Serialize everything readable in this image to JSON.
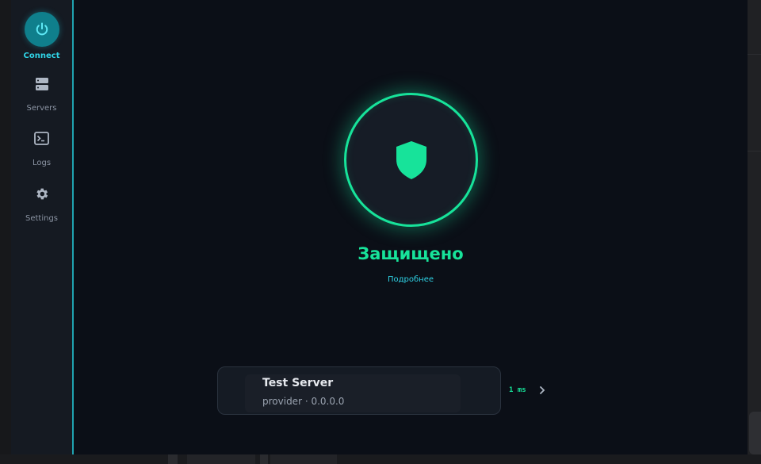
{
  "sidebar": {
    "items": [
      {
        "label": "Connect",
        "icon": "power-icon",
        "active": true
      },
      {
        "label": "Servers",
        "icon": "servers-icon",
        "active": false
      },
      {
        "label": "Logs",
        "icon": "terminal-icon",
        "active": false
      },
      {
        "label": "Settings",
        "icon": "gear-icon",
        "active": false
      }
    ]
  },
  "status": {
    "title": "Защищено",
    "details_link": "Подробнее",
    "icon": "shield-icon",
    "color": "#17e39a"
  },
  "server": {
    "name": "Test Server",
    "subtitle": "provider · 0.0.0.0",
    "ping": "1 ms",
    "chevron_icon": "chevron-right-icon"
  },
  "colors": {
    "accent": "#17e39a",
    "cyan": "#2fd3e6",
    "background": "#0b0f17",
    "sidebar": "#151a22"
  }
}
